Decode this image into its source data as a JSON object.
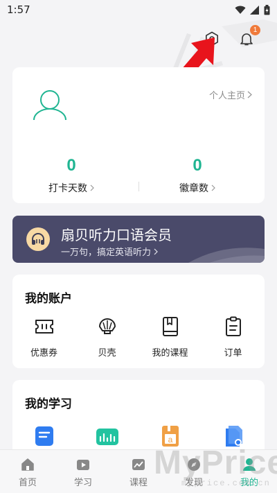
{
  "status_bar": {
    "time": "1:57"
  },
  "header": {
    "notification_count": "1"
  },
  "profile": {
    "homepage_link": "个人主页",
    "stats": [
      {
        "value": "0",
        "label": "打卡天数"
      },
      {
        "value": "0",
        "label": "徽章数"
      }
    ]
  },
  "vip": {
    "title": "扇贝听力口语会员",
    "subtitle": "一万句，搞定英语听力"
  },
  "account": {
    "title": "我的账户",
    "items": [
      {
        "label": "优惠券",
        "icon": "ticket-icon"
      },
      {
        "label": "贝壳",
        "icon": "shell-icon"
      },
      {
        "label": "我的课程",
        "icon": "book-icon"
      },
      {
        "label": "订单",
        "icon": "order-icon"
      }
    ]
  },
  "study": {
    "title": "我的学习",
    "items": [
      {
        "icon": "notes-icon"
      },
      {
        "icon": "stats-icon"
      },
      {
        "icon": "vocab-icon"
      },
      {
        "icon": "file-icon"
      }
    ]
  },
  "tabs": [
    {
      "label": "首页",
      "icon": "home-icon"
    },
    {
      "label": "学习",
      "icon": "play-icon"
    },
    {
      "label": "课程",
      "icon": "chart-icon"
    },
    {
      "label": "发现",
      "icon": "compass-icon"
    },
    {
      "label": "我的",
      "icon": "user-icon",
      "active": true
    }
  ],
  "watermark": {
    "text": "MyPrice",
    "sub": "myprice.com.cn"
  },
  "colors": {
    "accent": "#20b592",
    "badge": "#f07a3a",
    "vip_bg": "#4a4a6a",
    "arrow": "#e8141c"
  }
}
